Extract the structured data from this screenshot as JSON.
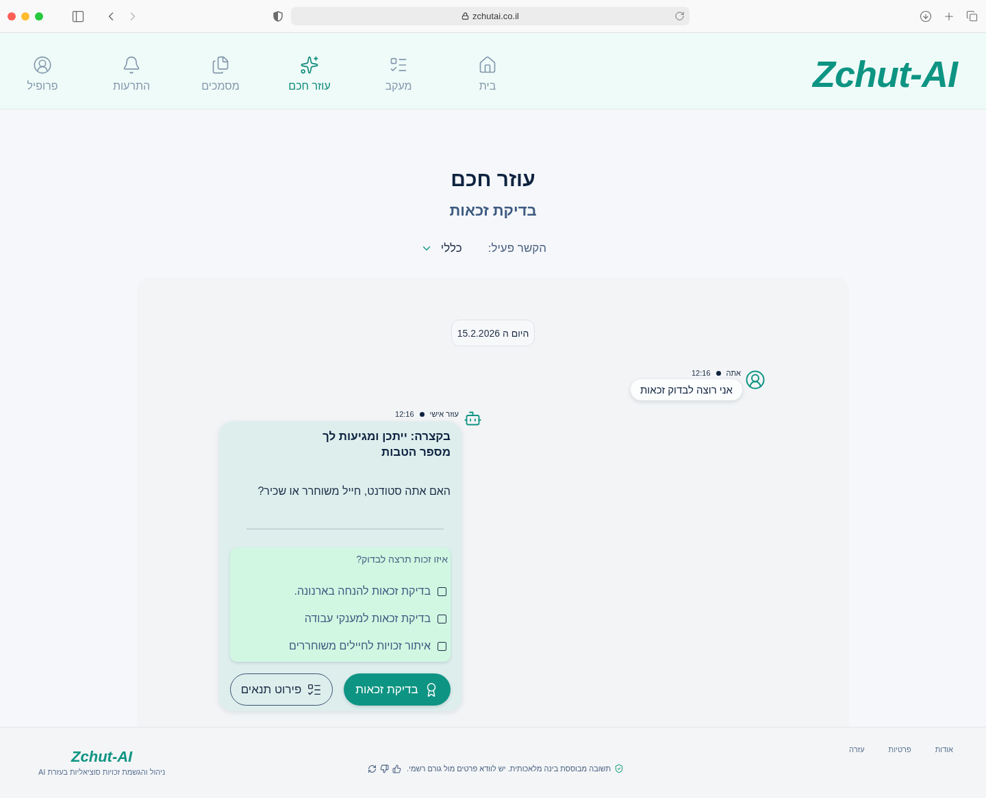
{
  "browser": {
    "url": "zchutai.co.il"
  },
  "header": {
    "logo": "Zchut-AI",
    "nav": [
      {
        "label": "בית",
        "selected": false
      },
      {
        "label": "מעקב",
        "selected": false
      },
      {
        "label": "עוזר חכם",
        "selected": true
      },
      {
        "label": "מסמכים",
        "selected": false
      },
      {
        "label": "התרעות",
        "selected": false
      },
      {
        "label": "פרופיל",
        "selected": false
      }
    ]
  },
  "page": {
    "title": "עוזר חכם",
    "subtitle": "בדיקת זכאות",
    "context": {
      "label": "הקשר פעיל:",
      "value": "כללי"
    }
  },
  "chat": {
    "date": "היום ה 15.2.2026",
    "messages": [
      {
        "kind": "user",
        "sender": "אתה",
        "time": "12:16",
        "text": "אני רוצה לבדוק זכאות"
      },
      {
        "kind": "assistant",
        "sender": "עוזר אישי",
        "time": "12:16",
        "title": "בקצרה: ייתכן ומגיעות לך מספר הטבות",
        "question": "האם אתה סטודנט, חייל משוחרר או שכיר?",
        "choices": {
          "prompt": "איזו זכות תרצה לבדוק?",
          "options": [
            {
              "label": "בדיקת זכאות להנחה בארנונה.",
              "checked": false
            },
            {
              "label": "בדיקת זכאות למענקי עבודה",
              "checked": false
            },
            {
              "label": "איתור זכויות לחיילים משוחררים",
              "checked": false
            }
          ]
        },
        "buttons": [
          {
            "kind": "primary",
            "label": "בדיקת זכאות"
          },
          {
            "kind": "secondary",
            "label": "פירוט תנאים"
          }
        ]
      }
    ]
  },
  "footer": {
    "links": [
      "אודות",
      "פרטיות",
      "עזרה"
    ],
    "disclaimer": "תשובה מבוססת בינה מלאכותית. יש לוודא פרטים מול גורם רשמי.",
    "brand": "Zchut-AI",
    "tagline": "ניהול והגשמת זכויות סוציאליות בעזרת AI"
  }
}
